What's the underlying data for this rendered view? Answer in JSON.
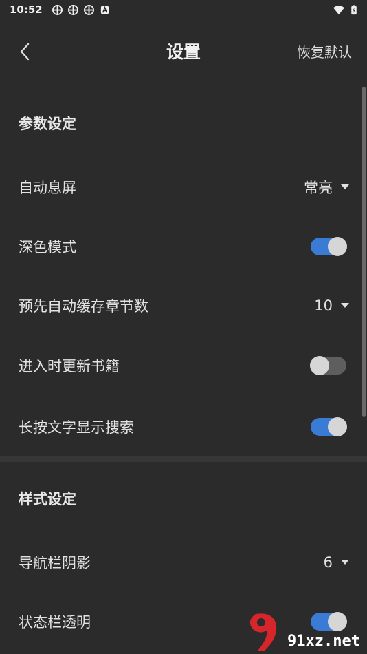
{
  "status_bar": {
    "time": "10:52",
    "notification_icons": [
      "app-notification-icon",
      "app-notification-icon",
      "app-notification-icon",
      "a-badge-icon"
    ],
    "right_icons": [
      "wifi-icon",
      "battery-charging-icon"
    ]
  },
  "header": {
    "title": "设置",
    "restore_label": "恢复默认"
  },
  "sections": {
    "params": {
      "title": "参数设定",
      "rows": [
        {
          "label": "自动息屏",
          "type": "dropdown",
          "value": "常亮"
        },
        {
          "label": "深色模式",
          "type": "toggle",
          "on": true
        },
        {
          "label": "预先自动缓存章节数",
          "type": "dropdown",
          "value": "10"
        },
        {
          "label": "进入时更新书籍",
          "type": "toggle",
          "on": false
        },
        {
          "label": "长按文字显示搜索",
          "type": "toggle",
          "on": true
        }
      ]
    },
    "style": {
      "title": "样式设定",
      "rows": [
        {
          "label": "导航栏阴影",
          "type": "dropdown",
          "value": "6"
        },
        {
          "label": "状态栏透明",
          "type": "toggle",
          "on": true
        }
      ]
    }
  },
  "watermark": {
    "text": "91xz.net"
  },
  "colors": {
    "background": "#2b2b2b",
    "accent": "#3a7bd5",
    "toggle_off": "#5e5e5e"
  }
}
